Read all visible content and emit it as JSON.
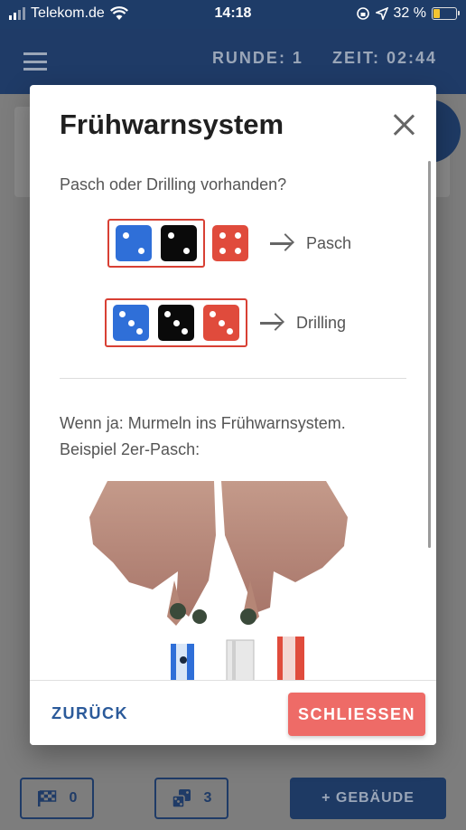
{
  "status_bar": {
    "carrier": "Telekom.de",
    "time": "14:18",
    "battery_text": "32 %",
    "battery_level": 0.32
  },
  "app_bar": {
    "round_label": "RUNDE: 1",
    "time_label": "ZEIT: 02:44"
  },
  "bottom_bar": {
    "flag_count": "0",
    "dice_count": "3",
    "building_button": "+ GEBÄUDE"
  },
  "dialog": {
    "title": "Frühwarnsystem",
    "question": "Pasch oder Drilling vorhanden?",
    "examples": [
      {
        "label": "Pasch",
        "dice": [
          {
            "color": "blue",
            "value": 2
          },
          {
            "color": "black",
            "value": 2
          },
          {
            "color": "red",
            "value": 4
          }
        ]
      },
      {
        "label": "Drilling",
        "dice": [
          {
            "color": "blue",
            "value": 3
          },
          {
            "color": "black",
            "value": 3
          },
          {
            "color": "red",
            "value": 3
          }
        ]
      }
    ],
    "instruction": "Wenn ja: Murmeln ins Frühwarnsystem.",
    "example_caption": "Beispiel 2er-Pasch:",
    "back_button": "ZURÜCK",
    "close_button": "SCHLIESSEN"
  },
  "colors": {
    "primary": "#1f3b67",
    "accent_button": "#ee6b67",
    "die_blue": "#2f6fd8",
    "die_black": "#0a0a0a",
    "die_red": "#e04b3c",
    "highlight_border": "#d84034"
  }
}
